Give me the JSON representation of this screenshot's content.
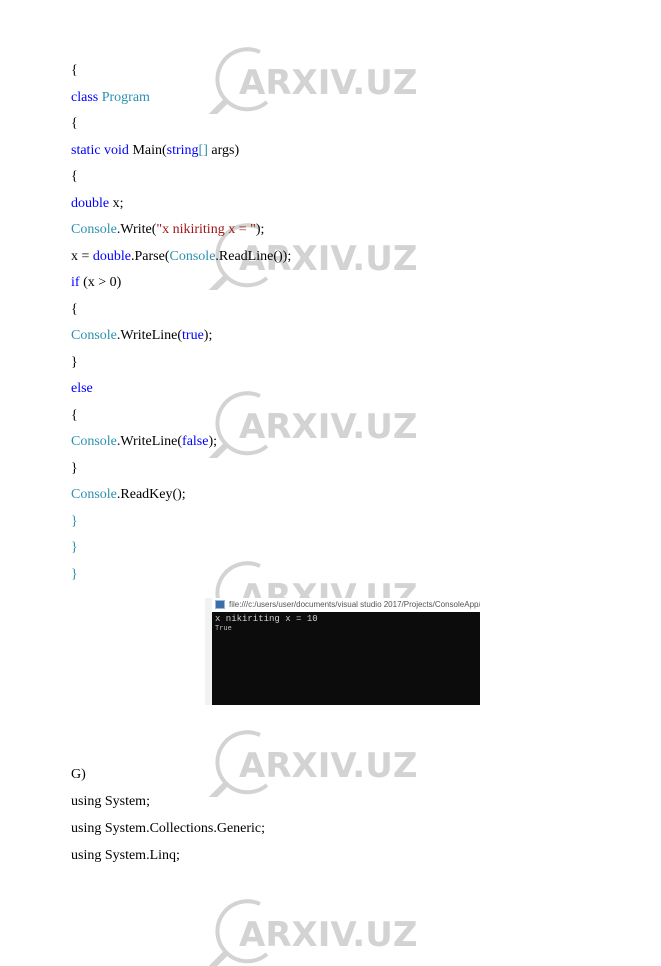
{
  "watermark": {
    "text": "ARXIV.UZ",
    "color": "#d3d3d3"
  },
  "colors": {
    "keyword": "#0000ff",
    "type": "#2b91af",
    "string": "#a31515",
    "plain": "#000000"
  },
  "code_lines": [
    {
      "tokens": [
        {
          "t": "{",
          "c": "pl"
        }
      ]
    },
    {
      "tokens": [
        {
          "t": "class ",
          "c": "kw"
        },
        {
          "t": "Program",
          "c": "ty"
        }
      ]
    },
    {
      "tokens": [
        {
          "t": "{",
          "c": "pl"
        }
      ]
    },
    {
      "tokens": [
        {
          "t": "static void ",
          "c": "kw"
        },
        {
          "t": "Main(",
          "c": "pl"
        },
        {
          "t": "string",
          "c": "kw"
        },
        {
          "t": "[]",
          "c": "ty"
        },
        {
          "t": " args)",
          "c": "pl"
        }
      ]
    },
    {
      "tokens": [
        {
          "t": "{",
          "c": "pl"
        }
      ]
    },
    {
      "tokens": [
        {
          "t": "double",
          "c": "kw"
        },
        {
          "t": " x;",
          "c": "pl"
        }
      ]
    },
    {
      "tokens": [
        {
          "t": "Console",
          "c": "ty"
        },
        {
          "t": ".Write(",
          "c": "pl"
        },
        {
          "t": "\"x nikiriting x = \"",
          "c": "st"
        },
        {
          "t": ");",
          "c": "pl"
        }
      ]
    },
    {
      "tokens": [
        {
          "t": "x = ",
          "c": "pl"
        },
        {
          "t": "double",
          "c": "kw"
        },
        {
          "t": ".Parse(",
          "c": "pl"
        },
        {
          "t": "Console",
          "c": "ty"
        },
        {
          "t": ".ReadLine());",
          "c": "pl"
        }
      ]
    },
    {
      "tokens": [
        {
          "t": "if",
          "c": "kw"
        },
        {
          "t": " (x > 0)",
          "c": "pl"
        }
      ]
    },
    {
      "tokens": [
        {
          "t": "{",
          "c": "pl"
        }
      ]
    },
    {
      "tokens": [
        {
          "t": "Console",
          "c": "ty"
        },
        {
          "t": ".WriteLine(",
          "c": "pl"
        },
        {
          "t": "true",
          "c": "kw"
        },
        {
          "t": ");",
          "c": "pl"
        }
      ]
    },
    {
      "tokens": [
        {
          "t": "}",
          "c": "pl"
        }
      ]
    },
    {
      "tokens": [
        {
          "t": "else",
          "c": "kw"
        }
      ]
    },
    {
      "tokens": [
        {
          "t": "{",
          "c": "pl"
        }
      ]
    },
    {
      "tokens": [
        {
          "t": "Console",
          "c": "ty"
        },
        {
          "t": ".WriteLine(",
          "c": "pl"
        },
        {
          "t": "false",
          "c": "kw"
        },
        {
          "t": ");",
          "c": "pl"
        }
      ]
    },
    {
      "tokens": [
        {
          "t": "}",
          "c": "pl"
        }
      ]
    },
    {
      "tokens": [
        {
          "t": "Console",
          "c": "ty"
        },
        {
          "t": ".ReadKey();",
          "c": "pl"
        }
      ]
    },
    {
      "tokens": [
        {
          "t": "}",
          "c": "ty"
        }
      ]
    },
    {
      "tokens": [
        {
          "t": "}",
          "c": "ty"
        }
      ]
    },
    {
      "tokens": [
        {
          "t": "}",
          "c": "ty"
        }
      ]
    }
  ],
  "console_screenshot": {
    "title": "file:///c:/users/user/documents/visual studio 2017/Projects/ConsoleApp/...",
    "output_lines": [
      "x nikiriting x = 10",
      "True"
    ]
  },
  "section_label": "G)",
  "using_lines": [
    "using System;",
    "using System.Collections.Generic;",
    "using System.Linq;"
  ]
}
